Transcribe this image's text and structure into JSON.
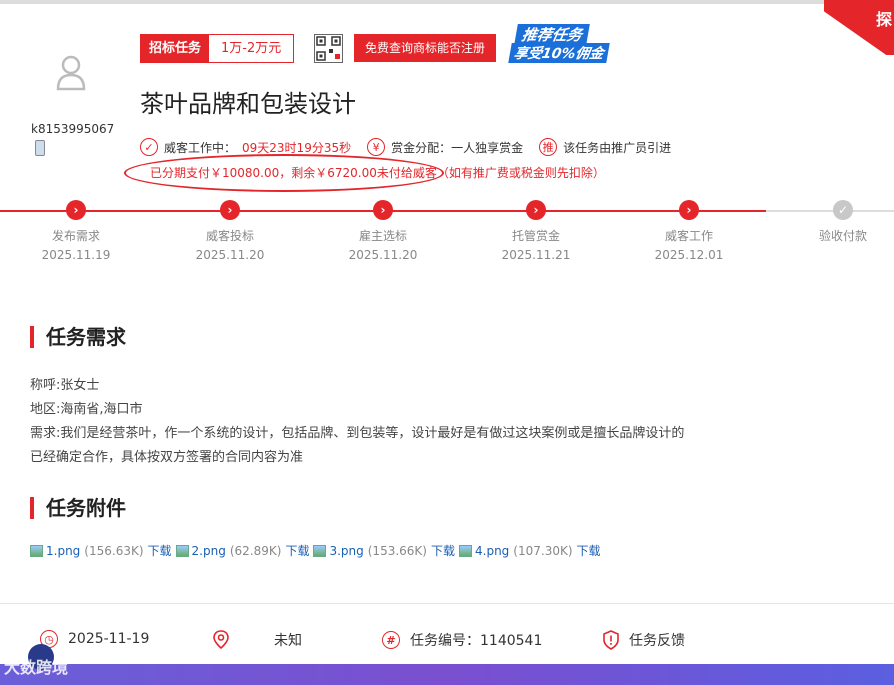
{
  "corner_badge": "探",
  "user": {
    "name": "k8153995067"
  },
  "bid": {
    "label": "招标任务",
    "price": "1万-2万元"
  },
  "check_button": "免费查询商标能否注册",
  "promo": {
    "line1": "推荐任务",
    "line2": "享受10%佣金"
  },
  "task_title": "茶叶品牌和包装设计",
  "meta": {
    "work_label": "威客工作中：",
    "countdown": "09天23时19分35秒",
    "bounty_label": "赏金分配：一人独享赏金",
    "promoter_badge": "推",
    "promoter_text": "该任务由推广员引进"
  },
  "payment_note": "已分期支付￥10080.00，剩余￥6720.00未付给威客（如有推广费或税金则先扣除）",
  "steps": [
    {
      "name": "发布需求",
      "date": "2025.11.19"
    },
    {
      "name": "威客投标",
      "date": "2025.11.20"
    },
    {
      "name": "雇主选标",
      "date": "2025.11.20"
    },
    {
      "name": "托管赏金",
      "date": "2025.11.21"
    },
    {
      "name": "威客工作",
      "date": "2025.12.01"
    },
    {
      "name": "验收付款",
      "date": ""
    }
  ],
  "requirements": {
    "heading": "任务需求",
    "lines": [
      "称呼:张女士",
      "地区:海南省,海口市",
      "需求:我们是经营茶叶，作一个系统的设计，包括品牌、到包装等，设计最好是有做过这块案例或是擅长品牌设计的",
      "已经确定合作，具体按双方签署的合同内容为准"
    ]
  },
  "attachments": {
    "heading": "任务附件",
    "download_label": "下载",
    "files": [
      {
        "name": "1.png",
        "size": "(156.63K)"
      },
      {
        "name": "2.png",
        "size": "(62.89K)"
      },
      {
        "name": "3.png",
        "size": "(153.66K)"
      },
      {
        "name": "4.png",
        "size": "(107.30K)"
      }
    ]
  },
  "footer": {
    "date": "2025-11-19",
    "location": "未知",
    "task_no": "任务编号：1140541",
    "feedback": "任务反馈"
  },
  "watermark": "大数跨境",
  "colors": {
    "accent": "#e4262b",
    "link": "#1a5fb4",
    "promo_blue": "#1a6fd8"
  }
}
